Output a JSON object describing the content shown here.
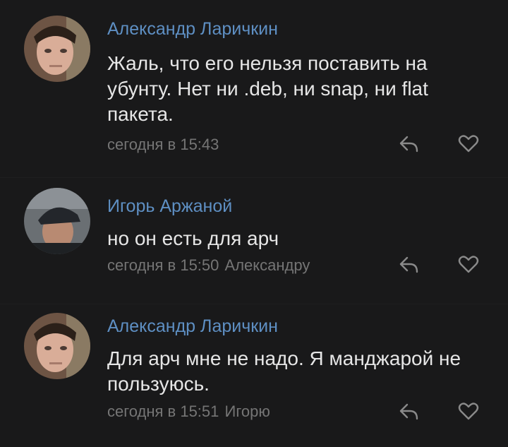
{
  "comments": [
    {
      "author": "Александр Ларичкин",
      "text": "Жаль, что его нельзя поставить на убунту. Нет ни .deb, ни snap, ни flat пакета.",
      "time": "сегодня в 15:43",
      "reply_to": ""
    },
    {
      "author": "Игорь Аржаной",
      "text": "но он есть для арч",
      "time": "сегодня в 15:50",
      "reply_to": "Александру"
    },
    {
      "author": "Александр Ларичкин",
      "text": "Для арч мне не надо. Я манджарой не пользуюсь.",
      "time": "сегодня в 15:51",
      "reply_to": "Игорю"
    }
  ],
  "icons": {
    "reply": "reply-arrow-icon",
    "like": "heart-icon"
  },
  "colors": {
    "background": "#19191a",
    "author": "#5e8fc3",
    "text": "#e6e6e6",
    "meta": "#757575"
  }
}
